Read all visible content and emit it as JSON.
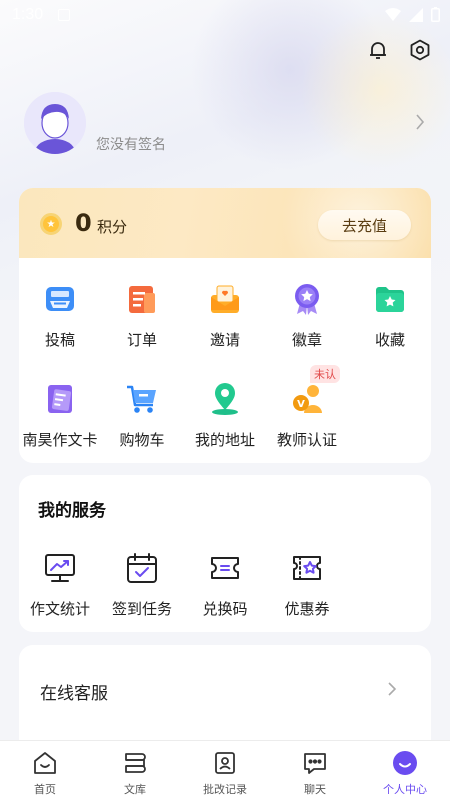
{
  "status_bar": {
    "time": "1:30"
  },
  "profile": {
    "signature": "您没有签名"
  },
  "points": {
    "value": "0",
    "unit": "积分",
    "recharge_label": "去充值"
  },
  "main_grid": [
    {
      "name": "submit",
      "label": "投稿",
      "icon": "submission-tray-icon"
    },
    {
      "name": "orders",
      "label": "订单",
      "icon": "order-list-icon"
    },
    {
      "name": "invite",
      "label": "邀请",
      "icon": "invite-envelope-icon"
    },
    {
      "name": "badges",
      "label": "徽章",
      "icon": "badge-medal-icon"
    },
    {
      "name": "favorites",
      "label": "收藏",
      "icon": "favorites-folder-icon"
    },
    {
      "name": "essay-card",
      "label": "南昊作文卡",
      "icon": "essay-card-icon"
    },
    {
      "name": "cart",
      "label": "购物车",
      "icon": "shopping-cart-icon"
    },
    {
      "name": "address",
      "label": "我的地址",
      "icon": "location-pin-icon"
    },
    {
      "name": "teacher-cert",
      "label": "教师认证",
      "icon": "teacher-cert-icon",
      "badge": "未认"
    }
  ],
  "services": {
    "title": "我的服务",
    "items": [
      {
        "name": "essay-stats",
        "label": "作文统计",
        "icon": "chart-monitor-icon"
      },
      {
        "name": "checkin",
        "label": "签到任务",
        "icon": "calendar-check-icon"
      },
      {
        "name": "redeem",
        "label": "兑换码",
        "icon": "ticket-icon"
      },
      {
        "name": "coupons",
        "label": "优惠券",
        "icon": "coupon-star-icon"
      }
    ]
  },
  "support": {
    "label": "在线客服"
  },
  "tabbar": [
    {
      "name": "home",
      "label": "首页",
      "icon": "home-icon",
      "active": false
    },
    {
      "name": "library",
      "label": "文库",
      "icon": "library-icon",
      "active": false
    },
    {
      "name": "records",
      "label": "批改记录",
      "icon": "records-icon",
      "active": false
    },
    {
      "name": "chat",
      "label": "聊天",
      "icon": "chat-icon",
      "active": false
    },
    {
      "name": "me",
      "label": "个人中心",
      "icon": "profile-icon",
      "active": true
    }
  ],
  "colors": {
    "accent": "#6a4cf0",
    "points_bar": "#fde9c4",
    "badge_red": "#e04848"
  }
}
